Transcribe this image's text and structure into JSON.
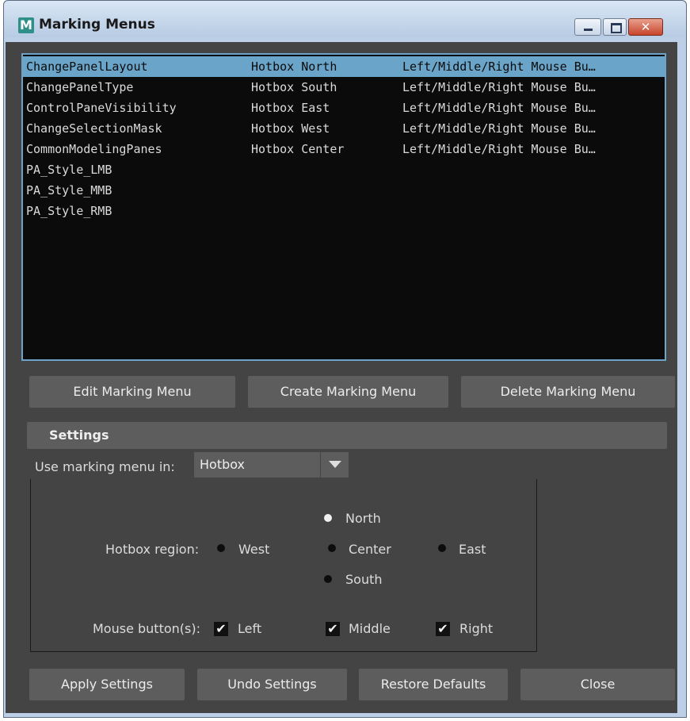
{
  "window": {
    "title": "Marking Menus",
    "icon_letter": "M"
  },
  "list": {
    "rows": [
      {
        "name": "ChangePanelLayout",
        "location": "Hotbox North",
        "buttons": "Left/Middle/Right Mouse Bu…",
        "selected": true
      },
      {
        "name": "ChangePanelType",
        "location": "Hotbox South",
        "buttons": "Left/Middle/Right Mouse Bu…"
      },
      {
        "name": "ControlPaneVisibility",
        "location": "Hotbox East",
        "buttons": "Left/Middle/Right Mouse Bu…"
      },
      {
        "name": "ChangeSelectionMask",
        "location": "Hotbox West",
        "buttons": "Left/Middle/Right Mouse Bu…"
      },
      {
        "name": "CommonModelingPanes",
        "location": "Hotbox Center",
        "buttons": "Left/Middle/Right Mouse Bu…"
      },
      {
        "name": "PA_Style_LMB",
        "location": "",
        "buttons": ""
      },
      {
        "name": "PA_Style_MMB",
        "location": "",
        "buttons": ""
      },
      {
        "name": "PA_Style_RMB",
        "location": "",
        "buttons": ""
      }
    ]
  },
  "actions": {
    "edit": "Edit Marking Menu",
    "create": "Create Marking Menu",
    "delete": "Delete Marking Menu"
  },
  "settings": {
    "header": "Settings",
    "use_in_label": "Use marking menu in:",
    "use_in_value": "Hotbox",
    "region_label": "Hotbox region:",
    "regions": {
      "north": "North",
      "west": "West",
      "center": "Center",
      "east": "East",
      "south": "South"
    },
    "selected_region": "North",
    "mouse_label": "Mouse button(s):",
    "mouse": {
      "left": "Left",
      "middle": "Middle",
      "right": "Right"
    },
    "check_glyph": "✔"
  },
  "footer": {
    "apply": "Apply Settings",
    "undo": "Undo Settings",
    "restore": "Restore Defaults",
    "close": "Close"
  },
  "colors": {
    "selection": "#6aa4c8",
    "panel": "#444444",
    "button": "#5d5d5d",
    "list_bg": "#0b0b0b"
  }
}
